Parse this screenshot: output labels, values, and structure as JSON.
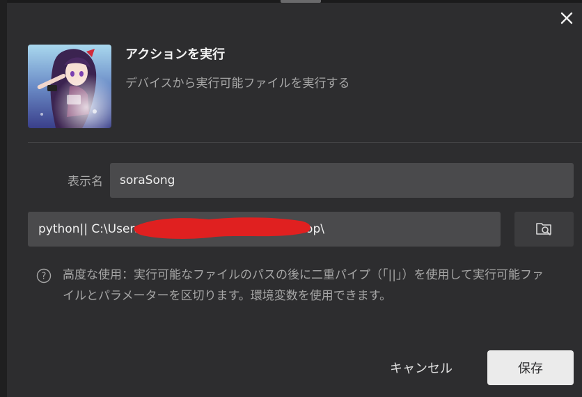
{
  "header": {
    "title": "アクションを実行",
    "subtitle": "デバイスから実行可能ファイルを実行する",
    "close_icon": "close-icon"
  },
  "form": {
    "display_name_label": "表示名",
    "display_name_value": "soraSong",
    "path_value": "python|| C:\\Users\\                                        \\loupedeck\\code\\ytmdesktop\\",
    "browse_icon": "folder-search-icon"
  },
  "help": {
    "icon": "question-circle-icon",
    "text": "高度な使用：実行可能なファイルのパスの後に二重パイプ（「||」）を使用して実行可能ファイルとパラメーターを区切ります。環境変数を使用できます。"
  },
  "footer": {
    "cancel_label": "キャンセル",
    "save_label": "保存"
  },
  "colors": {
    "background": "#2d2d2f",
    "input_bg": "#4a4a4c",
    "save_bg": "#ebebeb",
    "redaction": "#e02020"
  }
}
